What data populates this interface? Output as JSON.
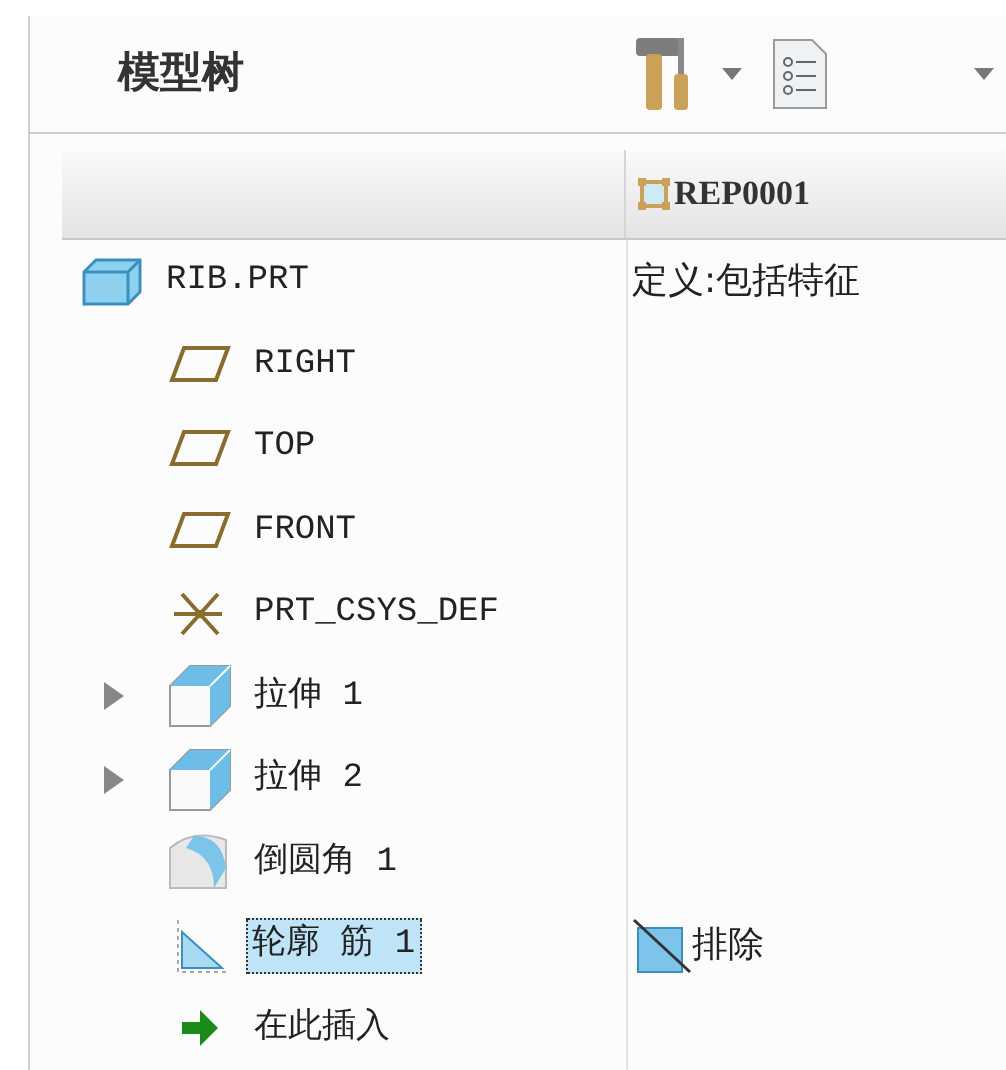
{
  "panel": {
    "title": "模型树"
  },
  "columns": [
    {
      "label": "REP0001"
    }
  ],
  "tree": [
    {
      "label": "RIB.PRT",
      "kind": "part",
      "selected": false,
      "column_2": {
        "excluded": false,
        "text": "定义:包括特征"
      },
      "children": [
        {
          "label": "RIGHT",
          "kind": "plane",
          "selected": false
        },
        {
          "label": "TOP",
          "kind": "plane",
          "selected": false
        },
        {
          "label": "FRONT",
          "kind": "plane",
          "selected": false
        },
        {
          "label": "PRT_CSYS_DEF",
          "kind": "csys",
          "selected": false
        },
        {
          "label": "拉伸 1",
          "kind": "extrude",
          "selected": false,
          "expanded": false
        },
        {
          "label": "拉伸 2",
          "kind": "extrude",
          "selected": false,
          "expanded": false
        },
        {
          "label": "倒圆角 1",
          "kind": "round",
          "selected": false
        },
        {
          "label": "轮廓 筋 1",
          "kind": "rib",
          "selected": true,
          "column_2": {
            "excluded": true,
            "text": "排除"
          }
        },
        {
          "label": "在此插入",
          "kind": "insert",
          "selected": false
        }
      ]
    }
  ]
}
